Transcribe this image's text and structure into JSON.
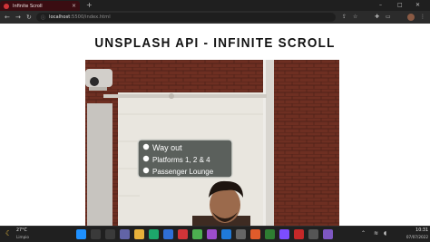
{
  "browser": {
    "tab_title": "Infinite Scroll",
    "tab_close": "×",
    "new_tab": "+",
    "url_host": "localhost",
    "url_path": ":5500/index.html",
    "window_controls": {
      "minimize": "–",
      "maximize": "□",
      "close": "✕"
    },
    "nav": {
      "back": "←",
      "forward": "→",
      "reload": "↻"
    },
    "toolbar_icons": [
      "share-icon",
      "star-icon",
      "extensions-icon",
      "sidebar-icon",
      "profile-avatar",
      "menu-icon"
    ],
    "accent": "#d13438"
  },
  "page": {
    "title": "UNSPLASH API - INFINITE SCROLL",
    "photo": {
      "sign_lines": [
        "Way out",
        "Platforms 1, 2 & 4",
        "Passenger Lounge"
      ],
      "colors": {
        "brick": "#6e2f22",
        "wall": "#e9e6df",
        "sign": "#5b605c"
      }
    }
  },
  "taskbar": {
    "weather_temp": "27°C",
    "weather_desc": "Limpio",
    "clock_time": "10:31",
    "clock_date": "07/07/2022",
    "apps": [
      {
        "name": "start-icon",
        "color": "#1e90ff"
      },
      {
        "name": "search-icon",
        "color": "#3a3a3a"
      },
      {
        "name": "task-view-icon",
        "color": "#3a3a3a"
      },
      {
        "name": "teams-icon",
        "color": "#6264a7"
      },
      {
        "name": "file-explorer-icon",
        "color": "#e8b23a"
      },
      {
        "name": "edge-icon",
        "color": "#1da76b"
      },
      {
        "name": "store-icon",
        "color": "#2f6fd6"
      },
      {
        "name": "chrome-icon",
        "color": "#d13438"
      },
      {
        "name": "app-icon-1",
        "color": "#4caf50"
      },
      {
        "name": "app-icon-2",
        "color": "#9c4dcc"
      },
      {
        "name": "vscode-icon",
        "color": "#1f7ad9"
      },
      {
        "name": "app-icon-3",
        "color": "#666666"
      },
      {
        "name": "app-icon-4",
        "color": "#e05b2b"
      },
      {
        "name": "app-icon-5",
        "color": "#2e7d32"
      },
      {
        "name": "app-icon-6",
        "color": "#7c4dff"
      },
      {
        "name": "app-icon-7",
        "color": "#c62828"
      },
      {
        "name": "app-icon-8",
        "color": "#555555"
      },
      {
        "name": "app-icon-9",
        "color": "#7e57c2"
      }
    ]
  }
}
